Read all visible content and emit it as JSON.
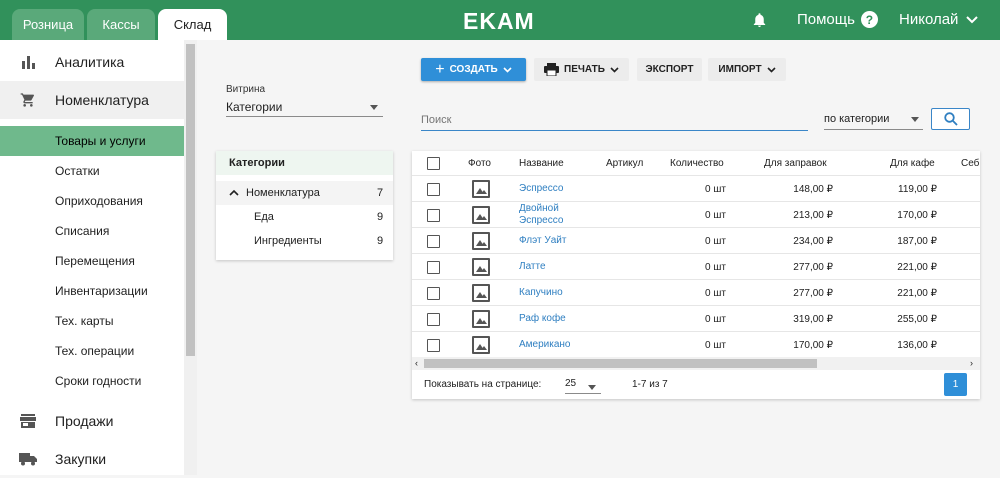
{
  "tabs": [
    {
      "label": "Розница",
      "active": false
    },
    {
      "label": "Кассы",
      "active": false
    },
    {
      "label": "Склад",
      "active": true
    }
  ],
  "app": {
    "logo": "EKAM"
  },
  "header": {
    "help_label": "Помощь",
    "user_name": "Николай"
  },
  "sidebar": {
    "main": [
      {
        "label": "Аналитика",
        "icon": "bar-chart-icon"
      },
      {
        "label": "Номенклатура",
        "icon": "cart-icon"
      },
      {
        "label": "Продажи",
        "icon": "store-icon"
      },
      {
        "label": "Закупки",
        "icon": "truck-icon"
      }
    ],
    "sub": [
      {
        "label": "Товары и услуги",
        "active": true
      },
      {
        "label": "Остатки"
      },
      {
        "label": "Оприходования"
      },
      {
        "label": "Списания"
      },
      {
        "label": "Перемещения"
      },
      {
        "label": "Инвентаризации"
      },
      {
        "label": "Тех. карты"
      },
      {
        "label": "Тех. операции"
      },
      {
        "label": "Сроки годности"
      }
    ]
  },
  "showcase": {
    "label": "Витрина",
    "value": "Категории"
  },
  "categories": {
    "title": "Категории",
    "rows": [
      {
        "label": "Номенклатура",
        "count": "7"
      },
      {
        "label": "Еда",
        "count": "9"
      },
      {
        "label": "Ингредиенты",
        "count": "9"
      }
    ]
  },
  "toolbar": {
    "create": "СОЗДАТЬ",
    "print": "ПЕЧАТЬ",
    "export": "ЭКСПОРТ",
    "import": "ИМПОРТ"
  },
  "search": {
    "placeholder": "Поиск",
    "scope": "по категории"
  },
  "table": {
    "headers": {
      "photo": "Фото",
      "name": "Название",
      "article": "Артикул",
      "qty": "Количество",
      "price_refuel": "Для заправок",
      "price_cafe": "Для кафе",
      "cost": "Себ"
    },
    "rows": [
      {
        "name": "Эспрессо",
        "qty": "0 шт",
        "refuel": "148,00 ₽",
        "cafe": "119,00 ₽"
      },
      {
        "name": "Двойной\nЭспрессо",
        "qty": "0 шт",
        "refuel": "213,00 ₽",
        "cafe": "170,00 ₽"
      },
      {
        "name": "Флэт Уайт",
        "qty": "0 шт",
        "refuel": "234,00 ₽",
        "cafe": "187,00 ₽"
      },
      {
        "name": "Латте",
        "qty": "0 шт",
        "refuel": "277,00 ₽",
        "cafe": "221,00 ₽"
      },
      {
        "name": "Капучино",
        "qty": "0 шт",
        "refuel": "277,00 ₽",
        "cafe": "221,00 ₽"
      },
      {
        "name": "Раф кофе",
        "qty": "0 шт",
        "refuel": "319,00 ₽",
        "cafe": "255,00 ₽"
      },
      {
        "name": "Американо",
        "qty": "0 шт",
        "refuel": "170,00 ₽",
        "cafe": "136,00 ₽"
      }
    ]
  },
  "pager": {
    "per_page_label": "Показывать на странице:",
    "per_page": "25",
    "range": "1-7 из 7",
    "page": "1"
  }
}
